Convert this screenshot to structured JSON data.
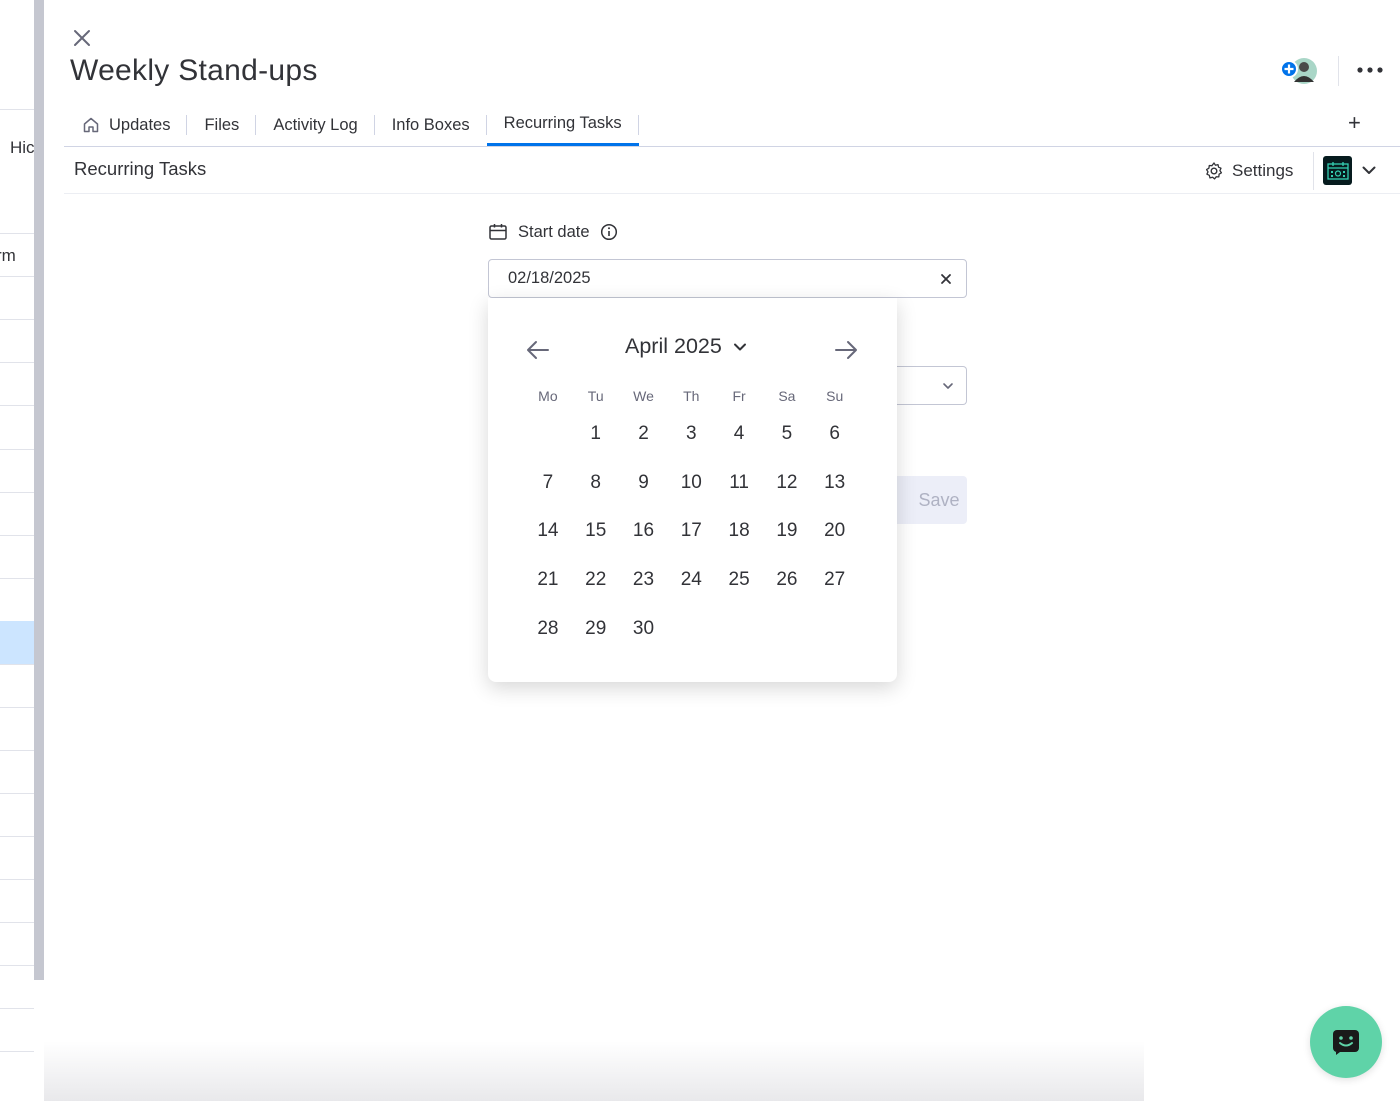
{
  "background": {
    "visible_texts": [
      "Hic",
      "rm"
    ]
  },
  "panel": {
    "title": "Weekly Stand-ups",
    "tabs": [
      {
        "label": "Updates",
        "icon": "home-icon"
      },
      {
        "label": "Files"
      },
      {
        "label": "Activity Log"
      },
      {
        "label": "Info Boxes"
      },
      {
        "label": "Recurring Tasks",
        "active": true
      }
    ],
    "add_tab_label": "+",
    "active_color": "#0073ea"
  },
  "subheader": {
    "title": "Recurring Tasks",
    "settings_label": "Settings"
  },
  "form": {
    "start_date_label": "Start date",
    "start_date_value": "02/18/2025",
    "save_label": "Save"
  },
  "calendar": {
    "month_label": "April 2025",
    "weekdays": [
      "Mo",
      "Tu",
      "We",
      "Th",
      "Fr",
      "Sa",
      "Su"
    ],
    "days": [
      "",
      "1",
      "2",
      "3",
      "4",
      "5",
      "6",
      "7",
      "8",
      "9",
      "10",
      "11",
      "12",
      "13",
      "14",
      "15",
      "16",
      "17",
      "18",
      "19",
      "20",
      "21",
      "22",
      "23",
      "24",
      "25",
      "26",
      "27",
      "28",
      "29",
      "30"
    ]
  },
  "colors": {
    "chat_button": "#5fd3a8",
    "app_icon_bg": "#061b1e",
    "save_disabled_bg": "#eceef8"
  }
}
